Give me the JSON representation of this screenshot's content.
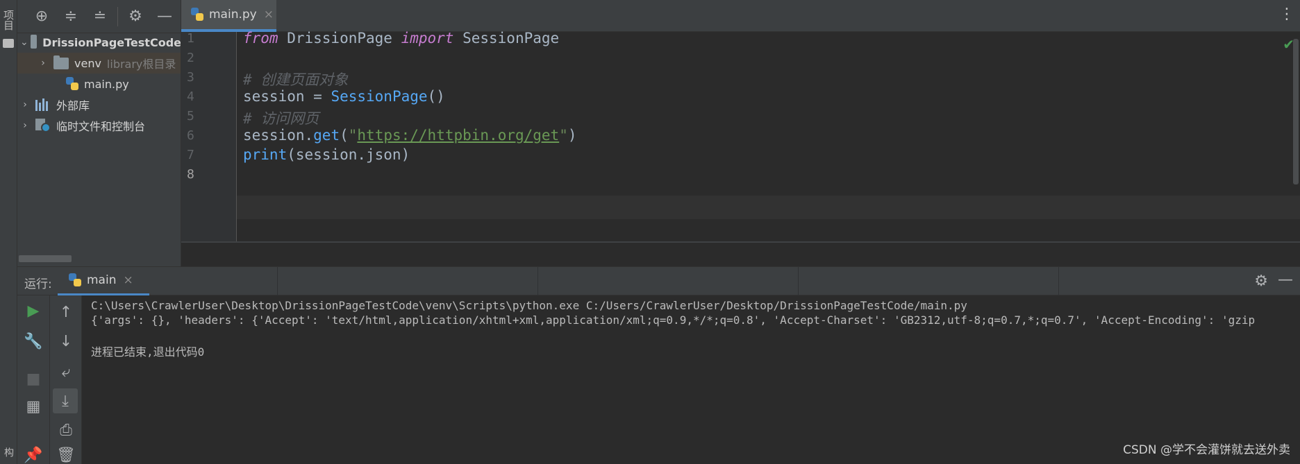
{
  "left_strip": {
    "top_label": "项目",
    "bottom_label": "构"
  },
  "project": {
    "toolbar_icons": [
      "crosshair-icon",
      "expand-all-icon",
      "collapse-all-icon",
      "gear-icon",
      "minimize-icon"
    ],
    "tree": [
      {
        "label": "DrissionPageTestCode",
        "extra": "",
        "type": "folder",
        "expanded": true
      },
      {
        "label": "venv",
        "extra": "library根目录",
        "type": "folder",
        "expanded": false
      },
      {
        "label": "main.py",
        "extra": "",
        "type": "python-file"
      },
      {
        "label": "外部库",
        "extra": "",
        "type": "library"
      },
      {
        "label": "临时文件和控制台",
        "extra": "",
        "type": "scratches"
      }
    ]
  },
  "editor": {
    "tab_label": "main.py",
    "line_numbers": [
      "1",
      "2",
      "3",
      "4",
      "5",
      "6",
      "7",
      "8"
    ],
    "code": {
      "l1_kw1": "from",
      "l1_mod": " DrissionPage ",
      "l1_kw2": "import",
      "l1_name": " SessionPage",
      "l3_comment": "# 创建页面对象",
      "l4_var": "session = ",
      "l4_fn": "SessionPage",
      "l4_paren": "()",
      "l5_comment": "# 访问网页",
      "l6_var": "session.",
      "l6_fn": "get",
      "l6_open": "(",
      "l6_q1": "\"",
      "l6_url": "https://httpbin.org/get",
      "l6_q2": "\"",
      "l6_close": ")",
      "l7_fn": "print",
      "l7_rest": "(session.json)"
    },
    "status_icon": "check-icon"
  },
  "run": {
    "label": "运行:",
    "tab_label": "main",
    "console": [
      "C:\\Users\\CrawlerUser\\Desktop\\DrissionPageTestCode\\venv\\Scripts\\python.exe C:/Users/CrawlerUser/Desktop/DrissionPageTestCode/main.py",
      "{'args': {}, 'headers': {'Accept': 'text/html,application/xhtml+xml,application/xml;q=0.9,*/*;q=0.8', 'Accept-Charset': 'GB2312,utf-8;q=0.7,*;q=0.7', 'Accept-Encoding': 'gzip",
      "",
      "进程已结束,退出代码0"
    ]
  },
  "watermark": "CSDN @学不会灌饼就去送外卖"
}
